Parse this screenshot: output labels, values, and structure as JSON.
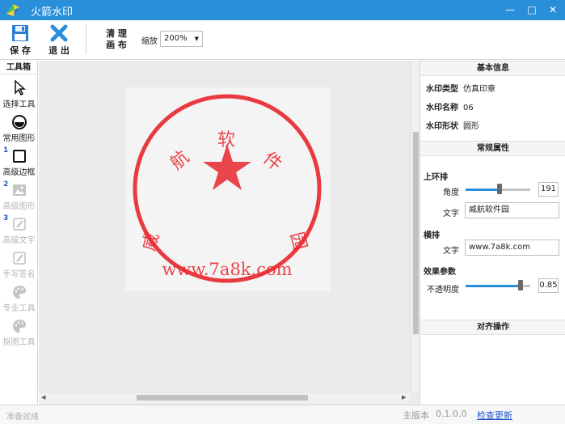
{
  "app": {
    "title": "火箭水印"
  },
  "window": {
    "minimize": "—",
    "maximize": "□",
    "close": "✕"
  },
  "toolbar": {
    "save_label": "保 存",
    "exit_label": "退 出",
    "clear_label_line1": "清 理",
    "clear_label_line2": "画 布",
    "zoom_label": "缩放",
    "zoom_value": "200%"
  },
  "toolbox": {
    "title": "工具箱",
    "tools": [
      {
        "label": "选择工具",
        "icon": "cursor-icon",
        "enabled": true
      },
      {
        "label": "常用图形",
        "icon": "shape-icon",
        "enabled": true
      },
      {
        "label": "高级边框",
        "icon": "border-icon",
        "enabled": true,
        "num": "1"
      },
      {
        "label": "高级图形",
        "icon": "image-icon",
        "enabled": false,
        "num": "2"
      },
      {
        "label": "高级文字",
        "icon": "edit-icon",
        "enabled": false,
        "num": "3"
      },
      {
        "label": "手写签名",
        "icon": "pen-icon",
        "enabled": false
      },
      {
        "label": "专业工具",
        "icon": "palette-icon",
        "enabled": false
      },
      {
        "label": "抠图工具",
        "icon": "palette-icon",
        "enabled": false
      }
    ]
  },
  "stamp": {
    "arc_text": [
      "威",
      "航",
      "软",
      "件",
      "园"
    ],
    "bottom_text": "www.7a8k.com",
    "color": "#e8262d"
  },
  "panel": {
    "basic_info_title": "基本信息",
    "type_label": "水印类型",
    "type_value": "仿真印章",
    "name_label": "水印名称",
    "name_value": "06",
    "shape_label": "水印形状",
    "shape_value": "圆形",
    "props_title": "常规属性",
    "ring_title": "上环排",
    "angle_label": "角度",
    "angle_value": "191",
    "angle_fraction": 0.53,
    "ring_text_label": "文字",
    "ring_text_value": "威航软件园",
    "horiz_title": "横排",
    "horiz_text_label": "文字",
    "horiz_text_value": "www.7a8k.com",
    "effect_title": "效果参数",
    "opacity_label": "不透明度",
    "opacity_value": "0.85",
    "opacity_fraction": 0.85,
    "align_title": "对齐操作"
  },
  "status": {
    "left": "准备就绪",
    "version_label": "主版本",
    "version_value": "0.1.0.0",
    "update_link": "检查更新"
  },
  "colors": {
    "accent": "#2a8fdb",
    "stamp_red": "#e8262d"
  }
}
